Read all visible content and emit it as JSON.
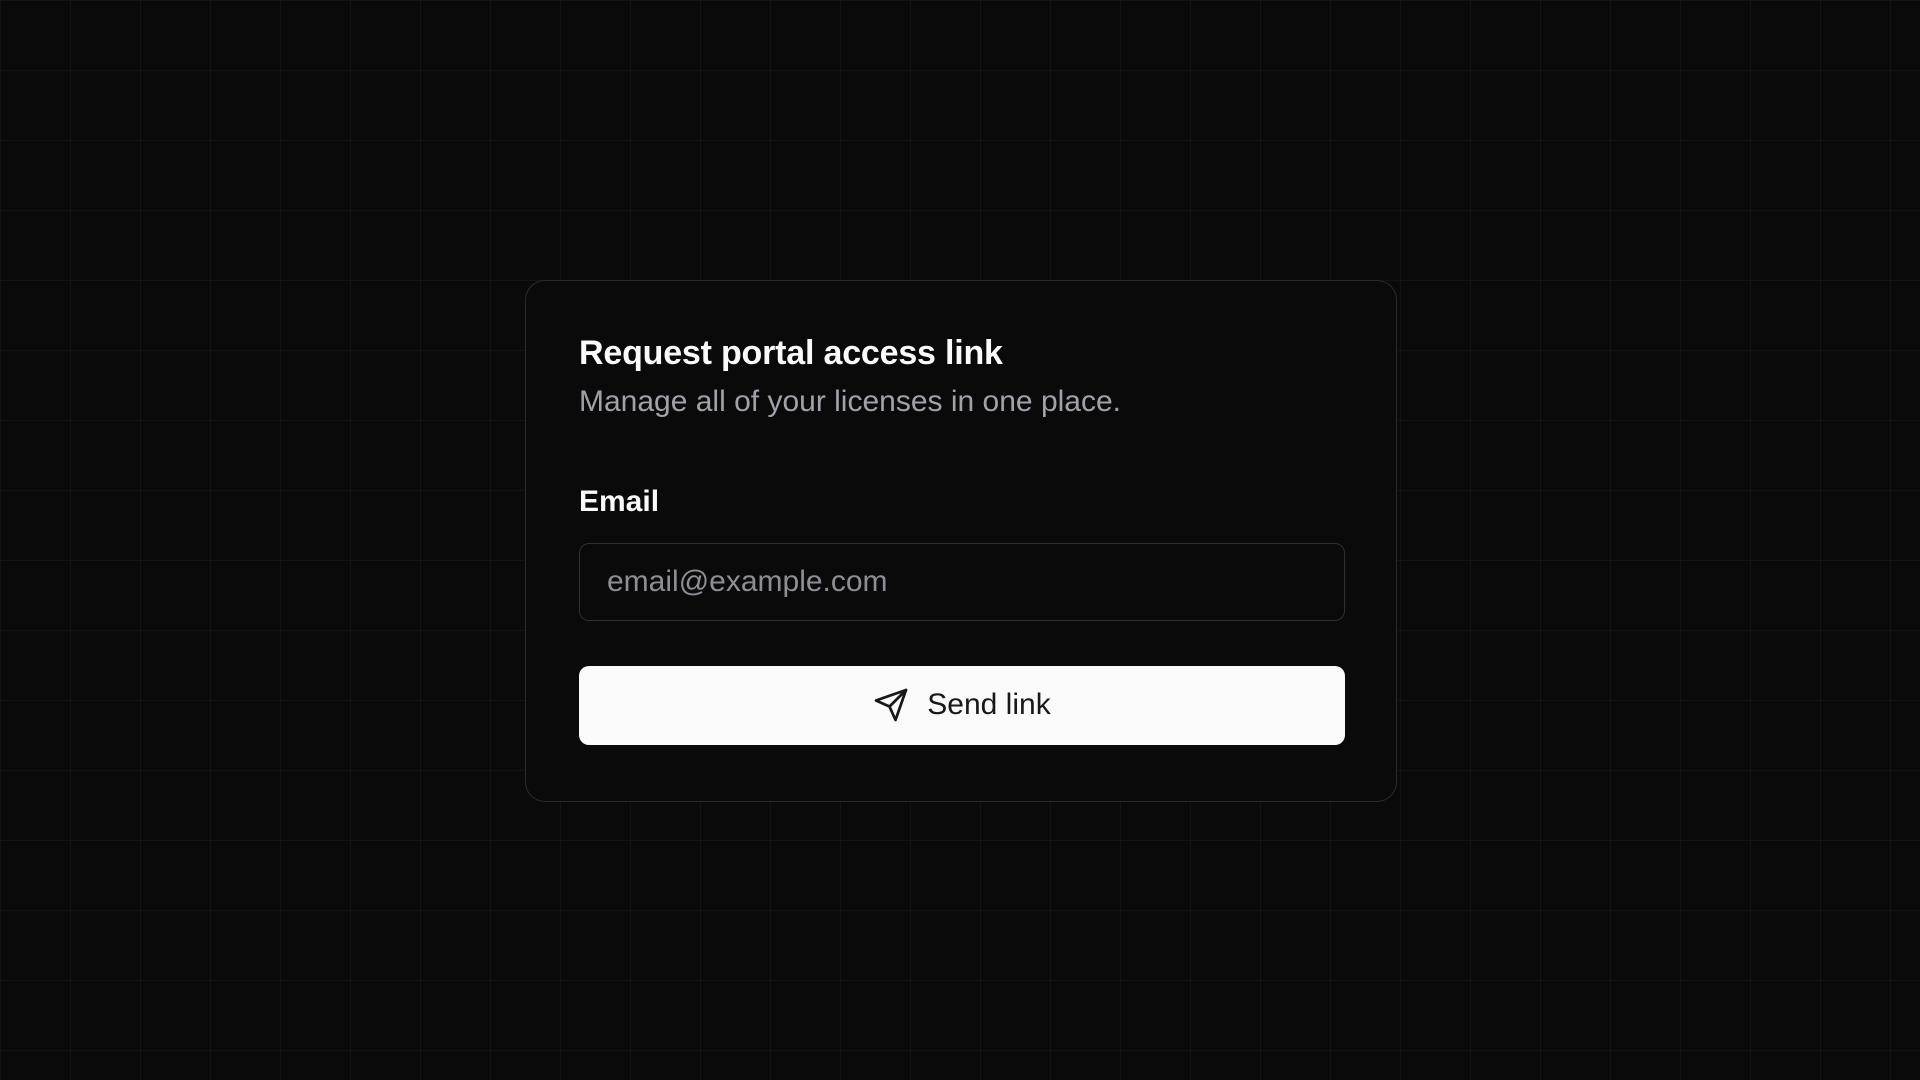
{
  "card": {
    "title": "Request portal access link",
    "subtitle": "Manage all of your licenses in one place."
  },
  "form": {
    "email_label": "Email",
    "email_value": "",
    "email_placeholder": "email@example.com",
    "submit_label": "Send link",
    "submit_icon": "send-icon"
  },
  "colors": {
    "background": "#0a0a0b",
    "card_border": "#2a2a2e",
    "muted_text": "#a1a1aa",
    "button_bg": "#fafafa",
    "button_text": "#18181b"
  }
}
